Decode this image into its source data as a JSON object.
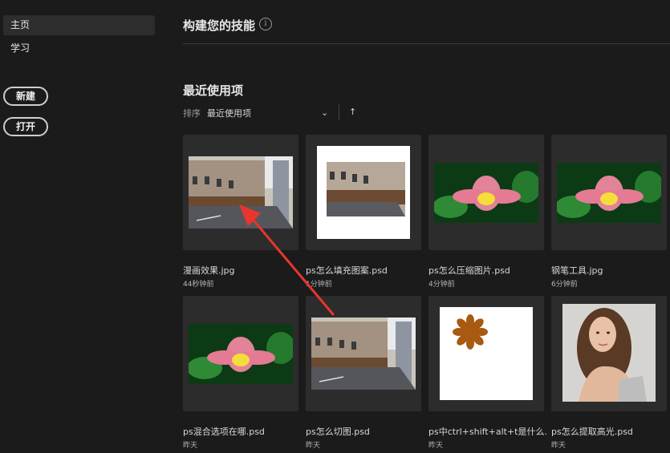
{
  "sidebar": {
    "items": [
      {
        "label": "主页",
        "active": true
      },
      {
        "label": "学习",
        "active": false
      }
    ],
    "new_button": "新建",
    "open_button": "打开"
  },
  "main": {
    "skills_title": "构建您的技能",
    "info_icon": "i",
    "recent_title": "最近使用项",
    "sort_label": "排序",
    "sort_value": "最近使用项",
    "chevron": "⌄",
    "sort_direction_icon": "↑"
  },
  "files": [
    {
      "name": "漫画效果.jpg",
      "time": "44秒钟前",
      "thumb": "street-icon"
    },
    {
      "name": "ps怎么填充图案.psd",
      "time": "1分钟前",
      "thumb": "street-framed-icon"
    },
    {
      "name": "ps怎么压缩图片.psd",
      "time": "4分钟前",
      "thumb": "lotus-icon"
    },
    {
      "name": "钢笔工具.jpg",
      "time": "6分钟前",
      "thumb": "lotus-icon"
    },
    {
      "name": "ps混合选项在哪.psd",
      "time": "昨天",
      "thumb": "lotus-icon"
    },
    {
      "name": "ps怎么切图.psd",
      "time": "昨天",
      "thumb": "street-icon"
    },
    {
      "name": "ps中ctrl+shift+alt+t是什么...",
      "time": "昨天",
      "thumb": "flower-shape-icon"
    },
    {
      "name": "ps怎么提取高光.psd",
      "time": "昨天",
      "thumb": "portrait-icon"
    }
  ],
  "colors": {
    "background": "#1b1b1b",
    "annotation_arrow": "#e8362d",
    "flower_shape": "#a85a10"
  }
}
